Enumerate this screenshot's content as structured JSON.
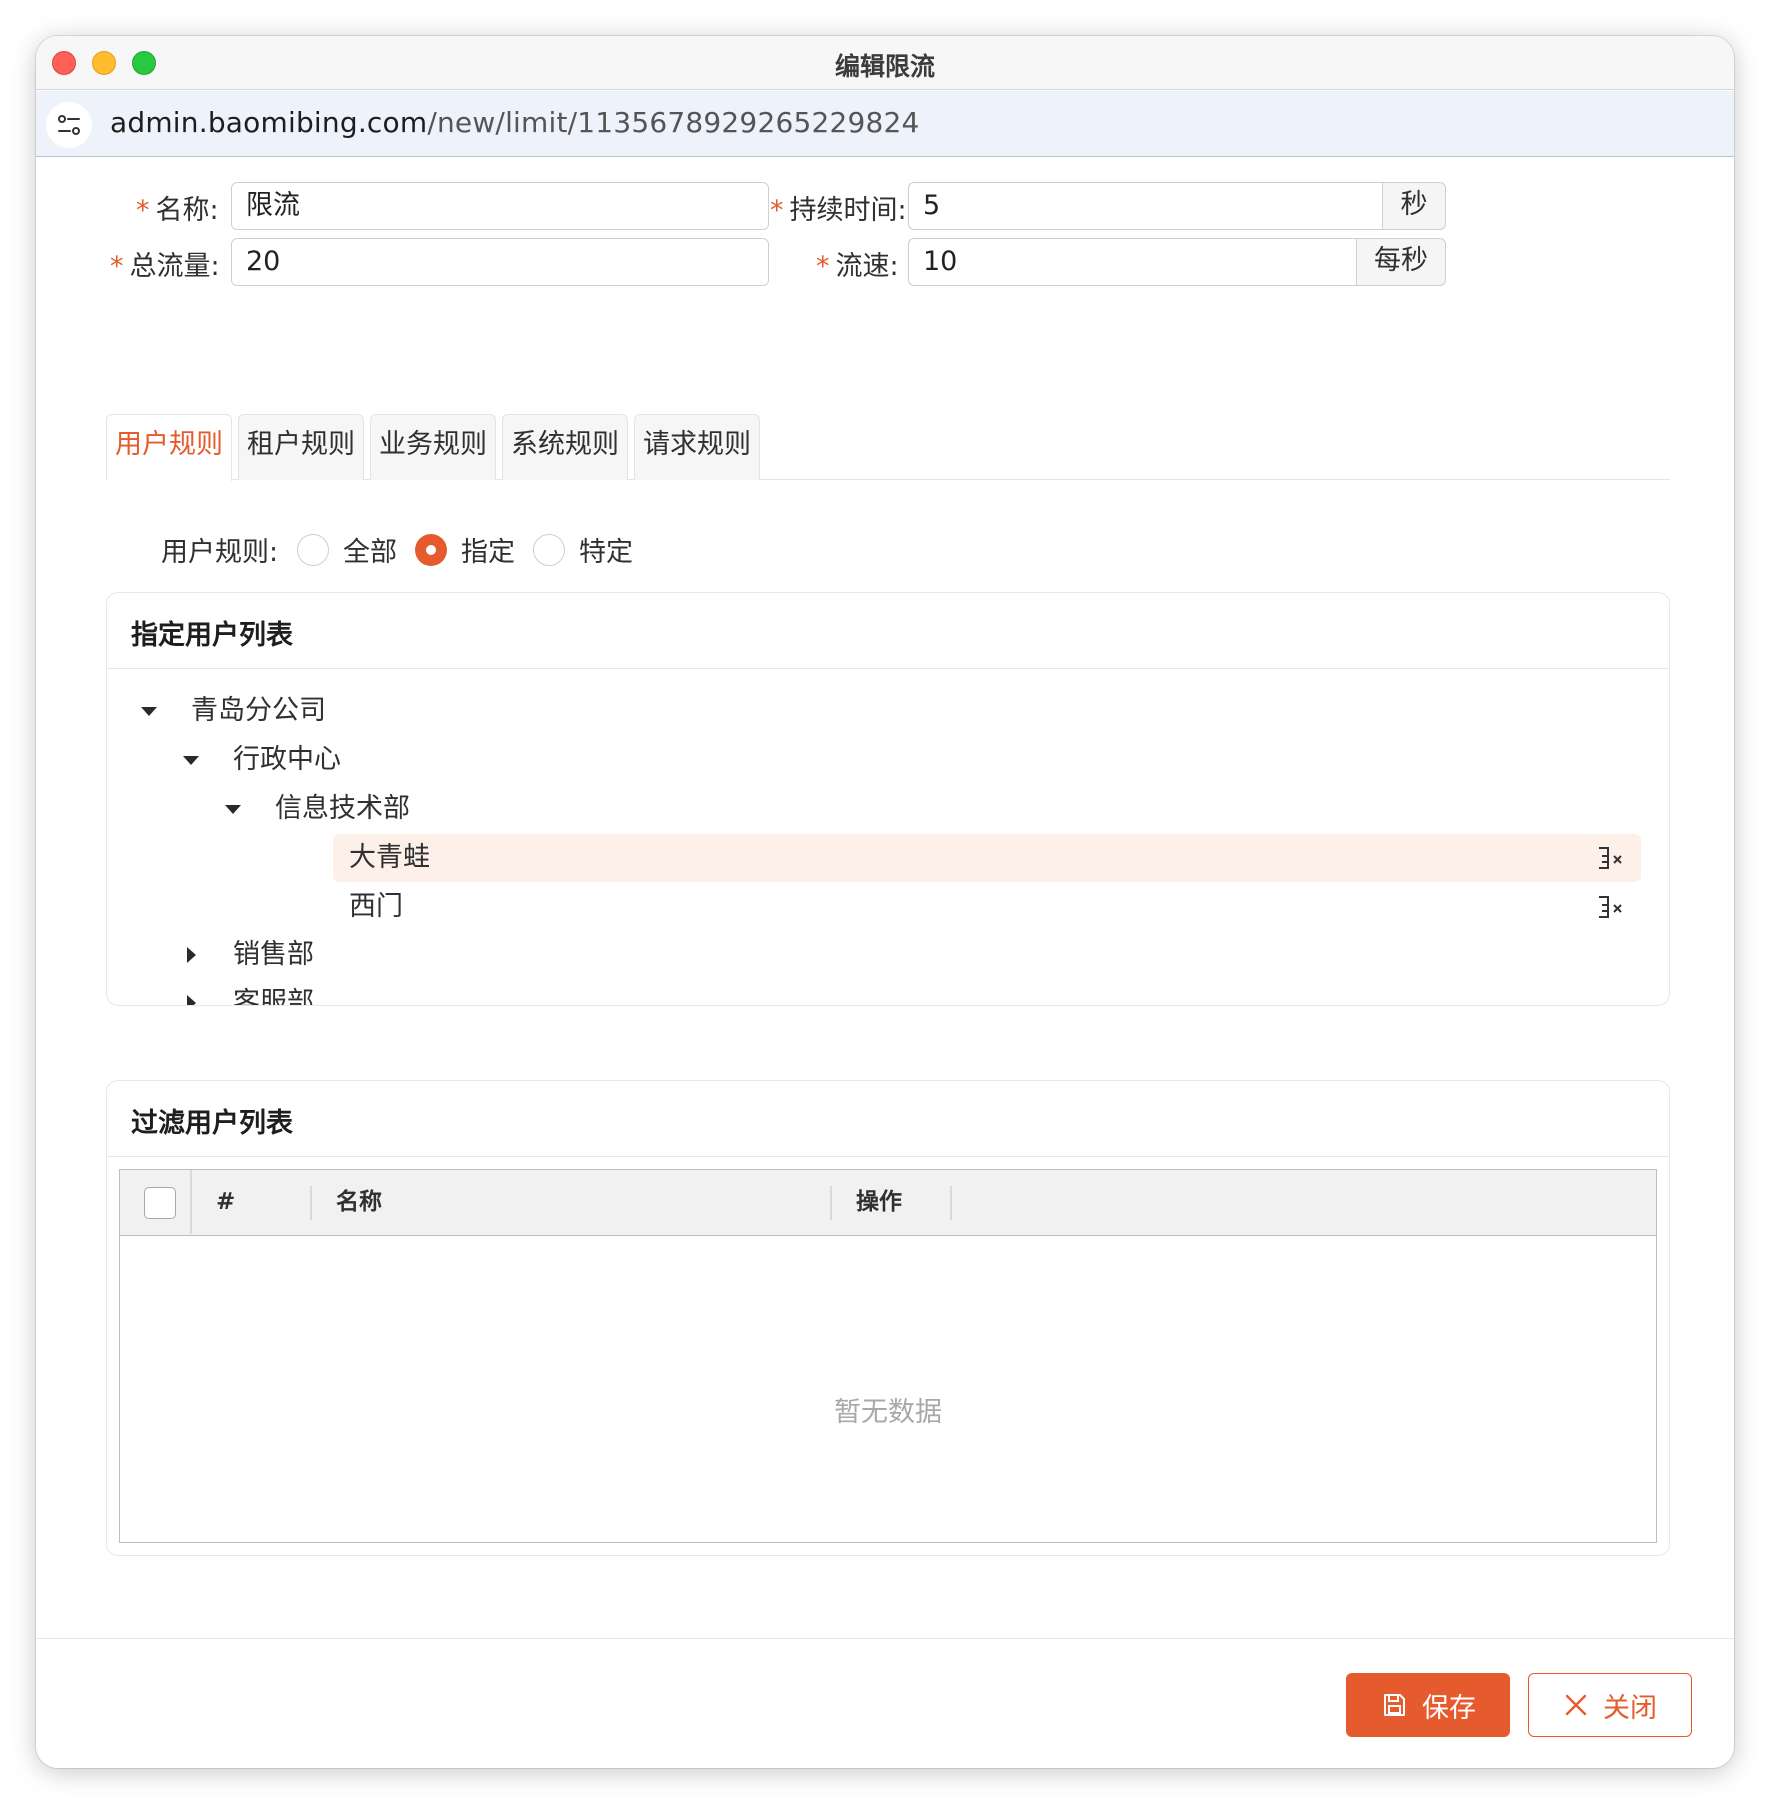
{
  "window": {
    "title": "编辑限流"
  },
  "address_bar": {
    "url_host": "admin.baomibing.com",
    "url_path": "/new/limit/1135678929265229824"
  },
  "form": {
    "required_mark": "*",
    "name": {
      "label": "名称:",
      "value": "限流"
    },
    "duration": {
      "label": "持续时间:",
      "value": "5",
      "unit": "秒"
    },
    "total": {
      "label": "总流量:",
      "value": "20"
    },
    "rate": {
      "label": "流速:",
      "value": "10",
      "unit": "每秒"
    }
  },
  "tabs": [
    {
      "label": "用户规则",
      "active": true
    },
    {
      "label": "租户规则",
      "active": false
    },
    {
      "label": "业务规则",
      "active": false
    },
    {
      "label": "系统规则",
      "active": false
    },
    {
      "label": "请求规则",
      "active": false
    }
  ],
  "user_rule": {
    "label": "用户规则:",
    "options": [
      {
        "label": "全部",
        "checked": false
      },
      {
        "label": "指定",
        "checked": true
      },
      {
        "label": "特定",
        "checked": false
      }
    ]
  },
  "specified_users": {
    "title": "指定用户列表",
    "tree": {
      "root": "青岛分公司",
      "admin_center": "行政中心",
      "it_dept": "信息技术部",
      "leaves": [
        {
          "label": "大青蛙",
          "selected": true,
          "icon": "remove-user-icon"
        },
        {
          "label": "西门",
          "selected": false,
          "icon": "remove-user-icon"
        }
      ],
      "sales": "销售部",
      "service": "客服部"
    }
  },
  "filter_users": {
    "title": "过滤用户列表",
    "columns": [
      "#",
      "名称",
      "操作"
    ],
    "empty_text": "暂无数据"
  },
  "footer": {
    "save_label": "保存",
    "close_label": "关闭"
  },
  "colors": {
    "accent": "#e55b2e",
    "selected_bg": "#fcf0e8"
  }
}
